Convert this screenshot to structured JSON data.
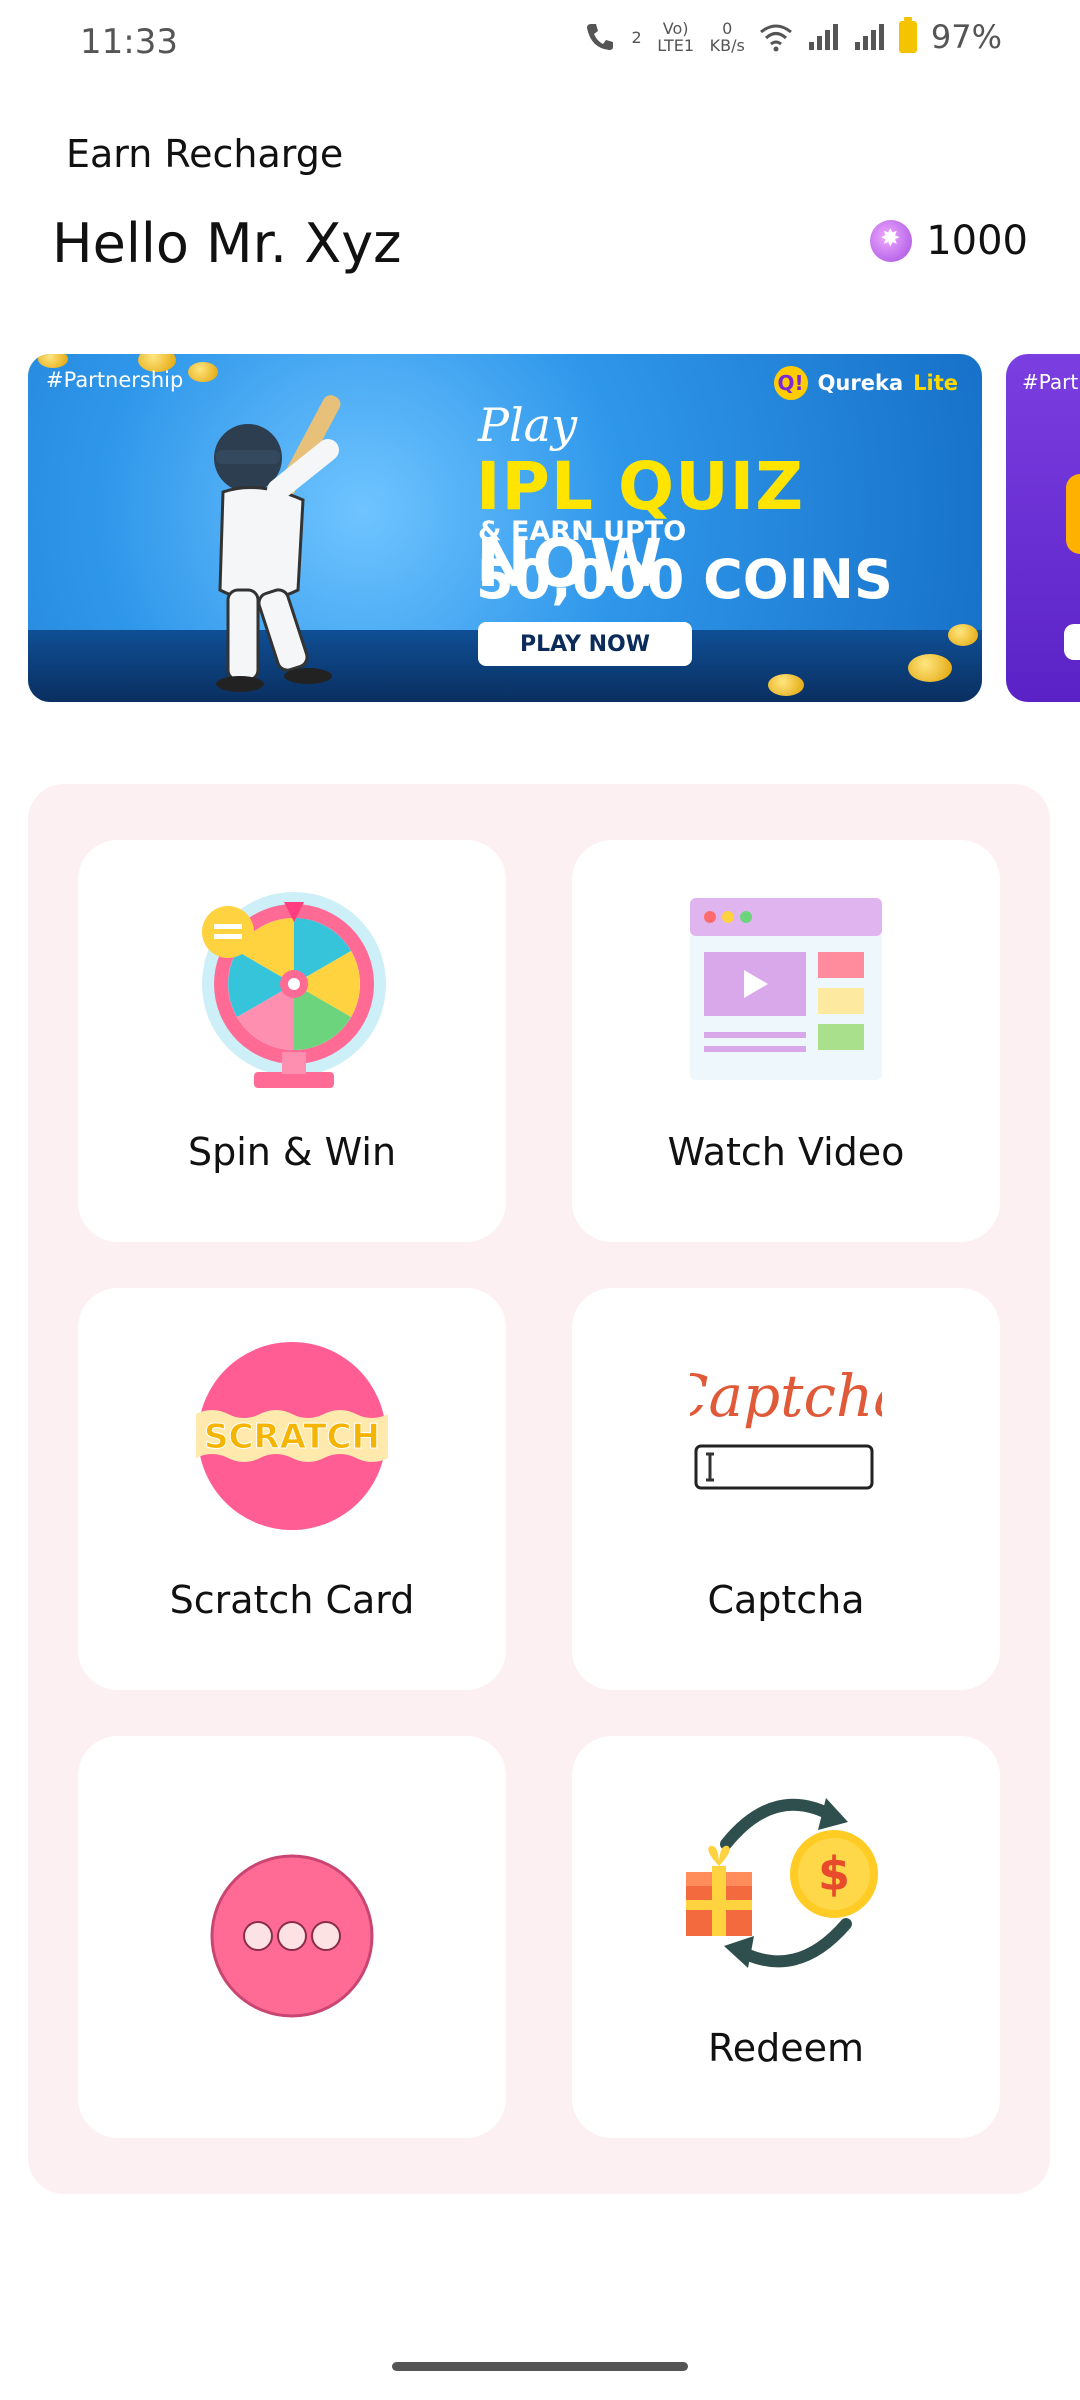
{
  "status_bar": {
    "time": "11:33",
    "network_sup": "2",
    "volte": "Vo) LTE1",
    "speed_value": "0",
    "speed_unit": "KB/s",
    "battery": "97%"
  },
  "header": {
    "app_title": "Earn Recharge",
    "greeting": "Hello Mr. Xyz",
    "coin_balance": "1000"
  },
  "banner": {
    "tag": "#Partnership",
    "brand_name": "Qureka",
    "brand_suffix": "Lite",
    "play_text": "Play",
    "headline_a": "IPL QUIZ",
    "headline_b": "NOW",
    "subline": "& EARN UPTO",
    "amount": "50,000 COINS",
    "cta": "PLAY NOW",
    "next_tag": "#Partr"
  },
  "cards": [
    {
      "label": "Spin & Win",
      "icon": "spin-wheel-icon"
    },
    {
      "label": "Watch Video",
      "icon": "video-player-icon"
    },
    {
      "label": "Scratch Card",
      "icon": "scratch-card-icon",
      "icon_text": "SCRATCH"
    },
    {
      "label": "Captcha",
      "icon": "captcha-icon",
      "icon_text": "Captcha"
    },
    {
      "label": "",
      "icon": "more-icon"
    },
    {
      "label": "Redeem",
      "icon": "redeem-exchange-icon"
    }
  ],
  "colors": {
    "panel_bg": "#fdf0f2",
    "card_bg": "#ffffff",
    "accent_pink": "#ff6b95",
    "coin_purple": "#a24ee0"
  }
}
